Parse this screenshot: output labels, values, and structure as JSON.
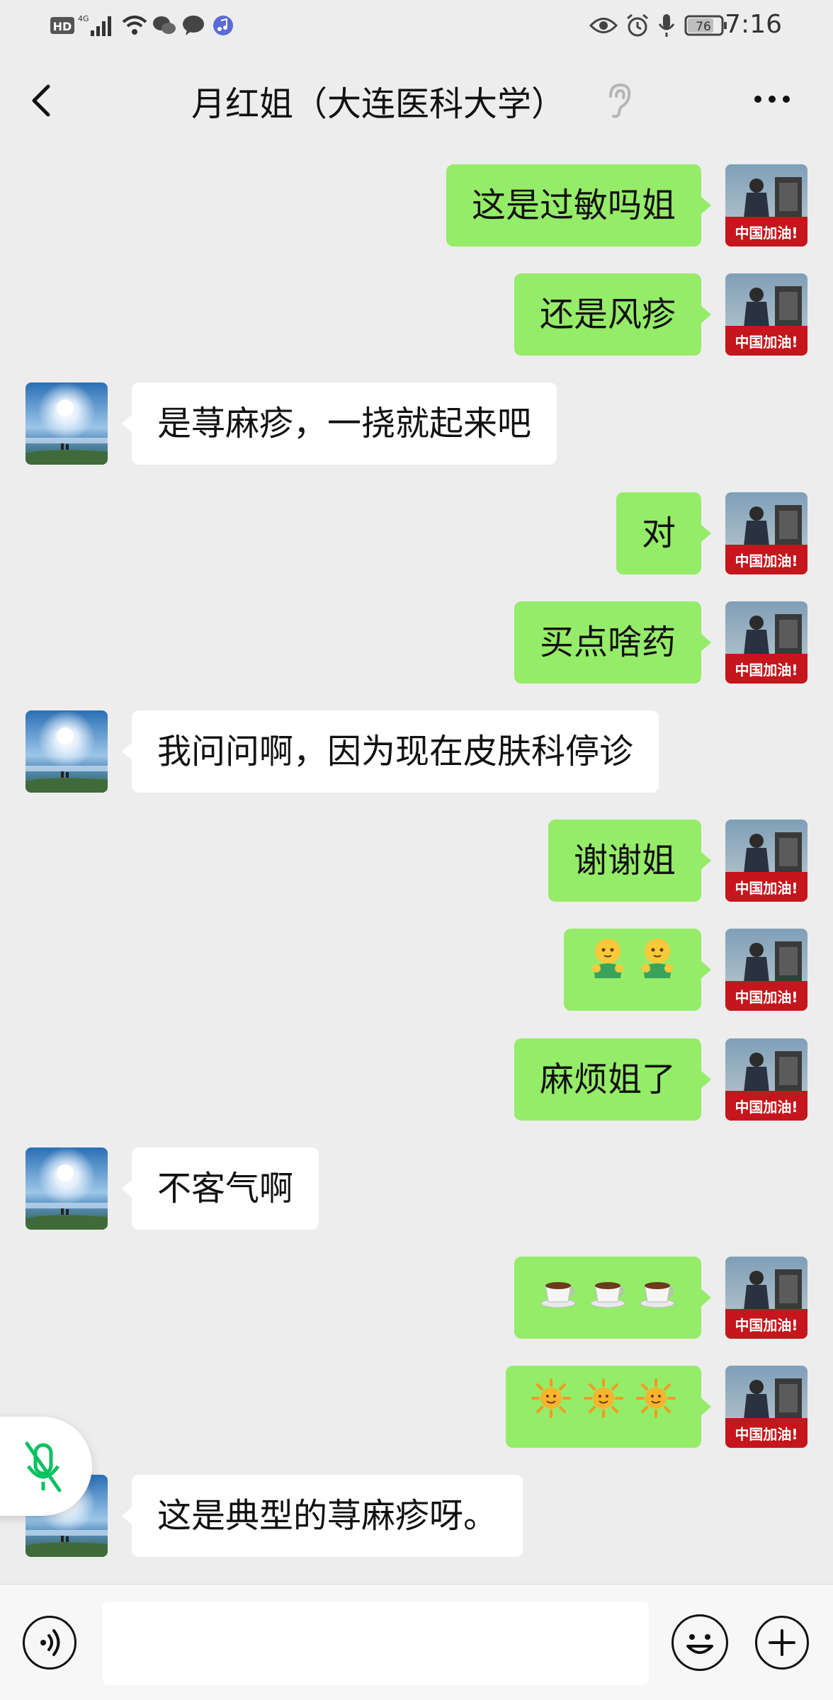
{
  "status_bar": {
    "time": "7:16",
    "battery": "76",
    "network": "4G",
    "hd_label": "HD"
  },
  "chat": {
    "title": "月红姐（大连医科大学）",
    "self_avatar_caption": "中国加油!",
    "messages": [
      {
        "side": "out",
        "text": "这是过敏吗姐"
      },
      {
        "side": "out",
        "text": "还是风疹"
      },
      {
        "side": "in",
        "text": "是荨麻疹，一挠就起来吧"
      },
      {
        "side": "out",
        "text": "对"
      },
      {
        "side": "out",
        "text": "买点啥药"
      },
      {
        "side": "in",
        "text": "我问问啊，因为现在皮肤科停诊"
      },
      {
        "side": "out",
        "text": "谢谢姐"
      },
      {
        "side": "out",
        "emoji": "green-face-hug",
        "count": 2
      },
      {
        "side": "out",
        "text": "麻烦姐了"
      },
      {
        "side": "in",
        "text": "不客气啊"
      },
      {
        "side": "out",
        "emoji": "coffee-cup",
        "count": 3
      },
      {
        "side": "out",
        "emoji": "sun-face",
        "count": 3
      },
      {
        "side": "in",
        "text": "这是典型的荨麻疹呀。"
      }
    ]
  },
  "icons": {
    "back": "chevron-left-icon",
    "ear": "earpiece-icon",
    "more": "more-dots-icon",
    "mic_muted": "mic-muted-icon",
    "voice": "voice-input-icon",
    "emoji": "emoji-icon",
    "plus": "plus-icon"
  },
  "colors": {
    "background": "#ededed",
    "out_bubble": "#95ec69",
    "in_bubble": "#ffffff",
    "mic_muted": "#07c160"
  }
}
